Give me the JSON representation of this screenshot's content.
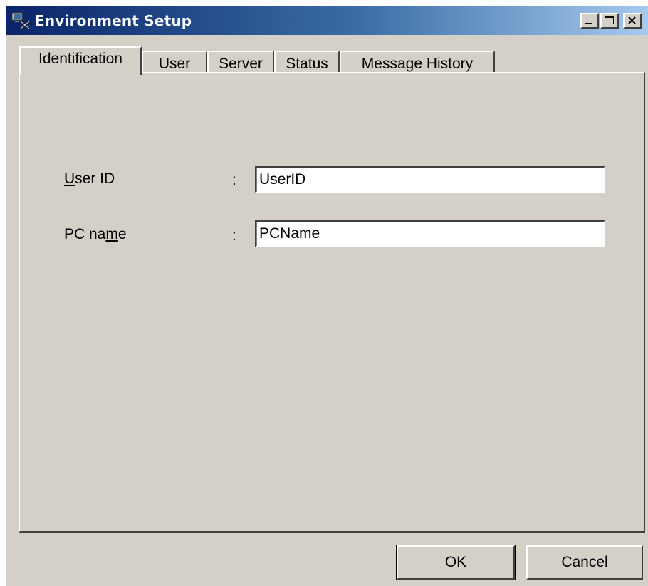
{
  "window": {
    "title": "Environment Setup",
    "icon": "environment-setup-icon",
    "controls": [
      "minimize-icon",
      "maximize-icon",
      "close-icon"
    ]
  },
  "tabs": [
    {
      "label": "Identification",
      "active": true
    },
    {
      "label": "User",
      "active": false
    },
    {
      "label": "Server",
      "active": false
    },
    {
      "label": "Status",
      "active": false
    },
    {
      "label": "Message History",
      "active": false
    }
  ],
  "identification": {
    "user_id": {
      "label_mnemonic": "U",
      "label_rest": "ser ID",
      "separator": ":",
      "value": "UserID"
    },
    "pc_name": {
      "label_pre": "PC na",
      "label_mnemonic": "m",
      "label_rest": "e",
      "separator": ":",
      "value": "PCName"
    }
  },
  "buttons": {
    "ok": "OK",
    "cancel": "Cancel"
  },
  "colors": {
    "face": "#d4d0c8",
    "title_start": "#0a246a",
    "title_end": "#a6caf0"
  }
}
